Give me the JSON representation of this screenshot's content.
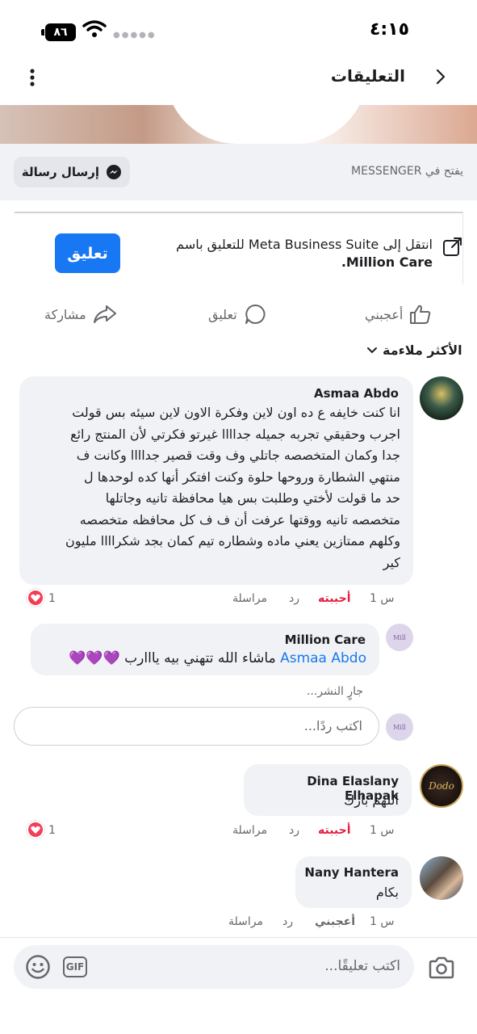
{
  "status_bar": {
    "time": "٤:١٥",
    "battery": "٨٦"
  },
  "header": {
    "title": "التعليقات"
  },
  "messenger": {
    "opens_in": "يفتح في MESSENGER",
    "send_button": "إرسال رسالة"
  },
  "business_suite": {
    "text": "انتقل إلى Meta Business Suite للتعليق باسم",
    "page_name": "Million Care.",
    "button": "تعليق"
  },
  "actions": {
    "like": "أعجبني",
    "comment": "تعليق",
    "share": "مشاركة"
  },
  "sort": {
    "label": "الأكثر ملاءمة"
  },
  "comments": [
    {
      "author": "Asmaa Abdo",
      "lines": [
        "انا كنت خايفه ع ده اون لاين وفكرة الاون لاين سيئه بس قولت",
        "اجرب وحقيقي تجربه جميله جداااا غيرتو فكرتي لأن المنتج رائع",
        "جدا وكمان المتخصصه جاتلي وف وقت قصير جداااا وكانت ف",
        "منتهي الشطارة وروحها حلوة وكنت افتكر أنها كده لوحدها ل",
        "حد ما قولت لأختي وطلبت بس هيا محافظة تانيه وجاتلها",
        "متخصصه تانيه ووقتها عرفت أن ف ف كل محافظه متخصصه",
        "وكلهم ممتازين يعني ماده وشطاره تيم كمان بجد شكراااا مليون",
        "كير"
      ],
      "time": "1 س",
      "like_label": "أحببته",
      "reply_label": "رد",
      "message_label": "مراسلة",
      "reactions": "1"
    },
    {
      "author": "Million Care",
      "mention": "Asmaa Abdo",
      "text": "ماشاء الله تتهني بيه يااارب 💜💜💜",
      "posting": "جارٍ النشر..."
    },
    {
      "author": "Dina Elaslany Elhapak",
      "text": "اللهم بارك",
      "time": "1 س",
      "like_label": "أحببته",
      "reply_label": "رد",
      "message_label": "مراسلة",
      "reactions": "1"
    },
    {
      "author": "Nany Hantera",
      "text": "بكام",
      "time": "1 س",
      "like_label": "أعجبني",
      "reply_label": "رد",
      "message_label": "مراسلة"
    }
  ],
  "reply_input": {
    "placeholder": "اكتب ردًا..."
  },
  "comment_input": {
    "placeholder": "اكتب تعليقًا...",
    "gif": "GIF"
  },
  "colors": {
    "accent": "#1877f2",
    "love": "#f33e58",
    "bubble": "#f0f2f5"
  }
}
